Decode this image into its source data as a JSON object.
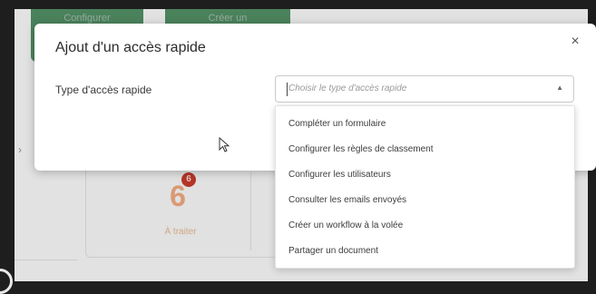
{
  "background": {
    "btn1_label": "Configurer",
    "btn2_label": "Créer un",
    "count": "6",
    "badge": "6",
    "count_label": "À traiter"
  },
  "modal": {
    "title": "Ajout d'un accès rapide",
    "close_icon": "×",
    "field_label": "Type d'accès rapide",
    "select_placeholder": "Choisir le type d'accès rapide",
    "select_arrow": "▲"
  },
  "dropdown": {
    "options": [
      "Compléter un formulaire",
      "Configurer les règles de classement",
      "Configurer les utilisateurs",
      "Consulter les emails envoyés",
      "Créer un workflow à la volée",
      "Partager un document"
    ]
  },
  "colors": {
    "brand_green": "#4f8b62",
    "badge_red": "#c0392b",
    "count_orange": "#e8a37c"
  }
}
